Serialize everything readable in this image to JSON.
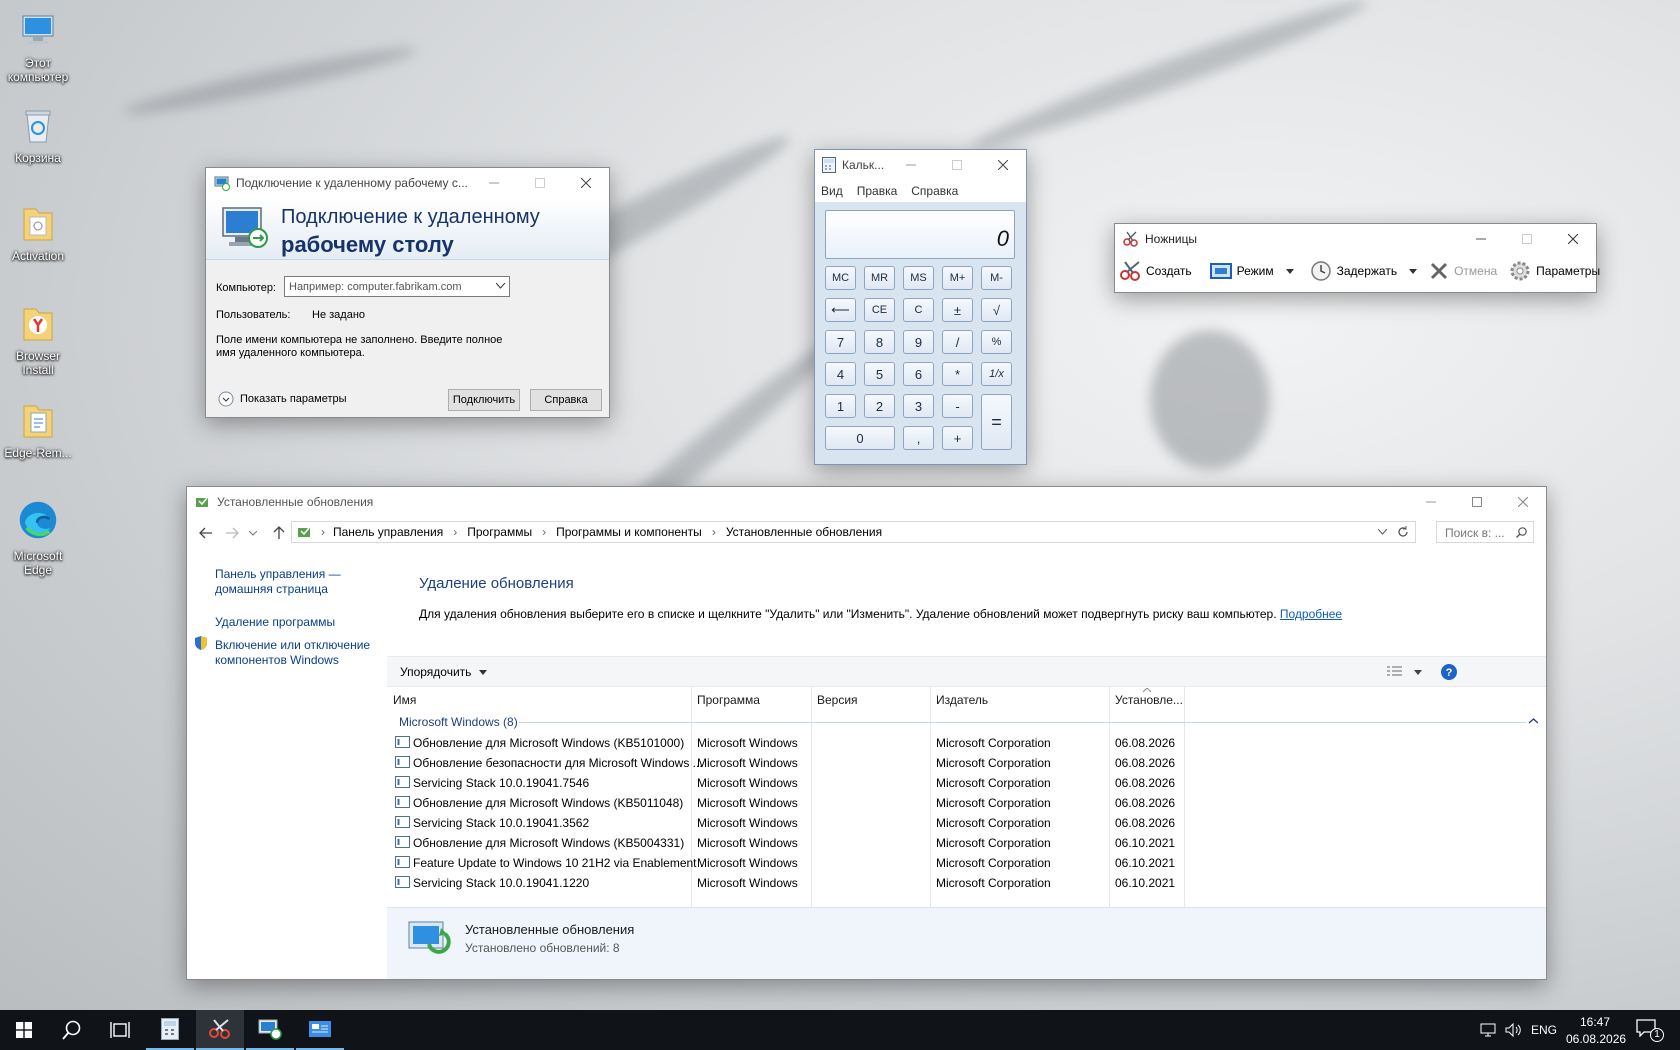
{
  "desktop": {
    "icons": [
      {
        "label": "Этот компьютер"
      },
      {
        "label": "Корзина"
      },
      {
        "label": "Activation"
      },
      {
        "label": "Browser Install"
      },
      {
        "label": "Edge-Rem..."
      },
      {
        "label": "Microsoft Edge"
      }
    ]
  },
  "rdp": {
    "title": "Подключение к удаленному рабочему с...",
    "header_line1": "Подключение к удаленному",
    "header_line2": "рабочему столу",
    "computer_label": "Компьютер:",
    "computer_placeholder": "Например: computer.fabrikam.com",
    "user_label": "Пользователь:",
    "user_value": "Не задано",
    "message": "Поле имени компьютера не заполнено. Введите полное имя удаленного компьютера.",
    "show_options": "Показать параметры",
    "connect_button": "Подключить",
    "help_button": "Справка"
  },
  "calc": {
    "title": "Кальк...",
    "menu": [
      "Вид",
      "Правка",
      "Справка"
    ],
    "display": "0",
    "keys": {
      "mc": "MC",
      "mr": "MR",
      "ms": "MS",
      "mplus": "M+",
      "mminus": "M-",
      "back": "⟵",
      "ce": "CE",
      "c": "C",
      "pm": "±",
      "sqrt": "√",
      "k7": "7",
      "k8": "8",
      "k9": "9",
      "div": "/",
      "pct": "%",
      "k4": "4",
      "k5": "5",
      "k6": "6",
      "mul": "*",
      "inv": "1/x",
      "k1": "1",
      "k2": "2",
      "k3": "3",
      "sub": "-",
      "eq": "=",
      "k0": "0",
      "dot": ",",
      "add": "+"
    }
  },
  "snip": {
    "title": "Ножницы",
    "new": "Создать",
    "mode": "Режим",
    "delay": "Задержать",
    "cancel": "Отмена",
    "options": "Параметры"
  },
  "updates": {
    "title": "Установленные обновления",
    "breadcrumb": [
      "Панель управления",
      "Программы",
      "Программы и компоненты",
      "Установленные обновления"
    ],
    "search_placeholder": "Поиск в: ...",
    "sidebar": {
      "home": "Панель управления — домашняя страница",
      "uninstall": "Удаление программы",
      "features": "Включение или отключение компонентов Windows"
    },
    "heading": "Удаление обновления",
    "description": "Для удаления обновления выберите его в списке и щелкните \"Удалить\" или \"Изменить\". Удаление обновлений может подвергнуть риску ваш компьютер.",
    "more_link": "Подробнее",
    "organize": "Упорядочить",
    "columns": [
      "Имя",
      "Программа",
      "Версия",
      "Издатель",
      "Установле..."
    ],
    "group": "Microsoft Windows (8)",
    "rows": [
      {
        "name": "Обновление для Microsoft Windows (KB5101000)",
        "program": "Microsoft Windows",
        "version": "",
        "publisher": "Microsoft Corporation",
        "installed": "06.08.2026"
      },
      {
        "name": "Обновление безопасности для Microsoft Windows ...",
        "program": "Microsoft Windows",
        "version": "",
        "publisher": "Microsoft Corporation",
        "installed": "06.08.2026"
      },
      {
        "name": "Servicing Stack 10.0.19041.7546",
        "program": "Microsoft Windows",
        "version": "",
        "publisher": "Microsoft Corporation",
        "installed": "06.08.2026"
      },
      {
        "name": "Обновление для Microsoft Windows (KB5011048)",
        "program": "Microsoft Windows",
        "version": "",
        "publisher": "Microsoft Corporation",
        "installed": "06.08.2026"
      },
      {
        "name": "Servicing Stack 10.0.19041.3562",
        "program": "Microsoft Windows",
        "version": "",
        "publisher": "Microsoft Corporation",
        "installed": "06.08.2026"
      },
      {
        "name": "Обновление для Microsoft Windows (KB5004331)",
        "program": "Microsoft Windows",
        "version": "",
        "publisher": "Microsoft Corporation",
        "installed": "06.10.2021"
      },
      {
        "name": "Feature Update to Windows 10 21H2 via Enablement ...",
        "program": "Microsoft Windows",
        "version": "",
        "publisher": "Microsoft Corporation",
        "installed": "06.10.2021"
      },
      {
        "name": "Servicing Stack 10.0.19041.1220",
        "program": "Microsoft Windows",
        "version": "",
        "publisher": "Microsoft Corporation",
        "installed": "06.10.2021"
      }
    ],
    "details_title": "Установленные обновления",
    "details_count": "Установлено обновлений: 8"
  },
  "taskbar": {
    "lang": "ENG",
    "time": "16:47",
    "date": "06.08.2026",
    "notifications": "1"
  }
}
